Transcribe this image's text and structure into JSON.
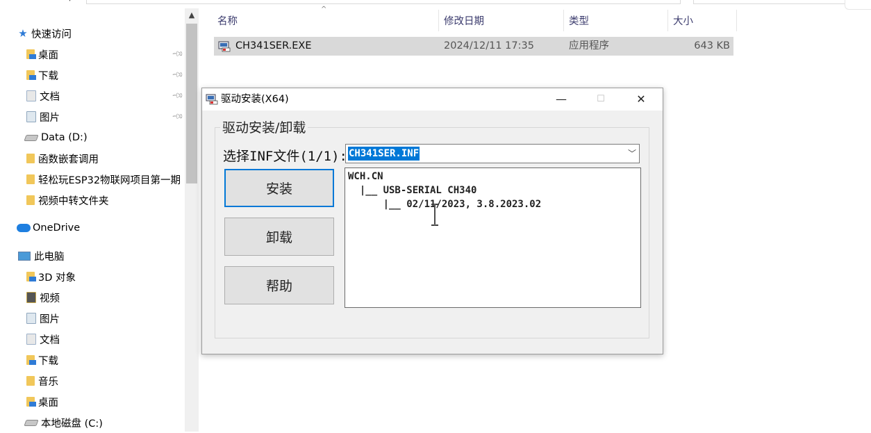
{
  "nav": {
    "items": [
      {
        "label": "快速访问",
        "icon": "star-icon"
      },
      {
        "label": "桌面",
        "icon": "folder-desktop-icon",
        "pinned": true
      },
      {
        "label": "下载",
        "icon": "folder-download-icon",
        "pinned": true
      },
      {
        "label": "文档",
        "icon": "folder-documents-icon",
        "pinned": true
      },
      {
        "label": "图片",
        "icon": "folder-pictures-icon",
        "pinned": true
      },
      {
        "label": "Data (D:)",
        "icon": "drive-icon"
      },
      {
        "label": "函数嵌套调用",
        "icon": "folder-icon"
      },
      {
        "label": "轻松玩ESP32物联网项目第一期",
        "icon": "folder-icon"
      },
      {
        "label": "视频中转文件夹",
        "icon": "folder-icon"
      },
      {
        "label": "OneDrive",
        "icon": "onedrive-cloud-icon"
      },
      {
        "label": "此电脑",
        "icon": "this-pc-icon"
      },
      {
        "label": "3D 对象",
        "icon": "folder-3d-icon"
      },
      {
        "label": "视频",
        "icon": "folder-videos-icon"
      },
      {
        "label": "图片",
        "icon": "folder-pictures-icon"
      },
      {
        "label": "文档",
        "icon": "folder-documents-icon"
      },
      {
        "label": "下载",
        "icon": "folder-download-icon"
      },
      {
        "label": "音乐",
        "icon": "folder-music-icon"
      },
      {
        "label": "桌面",
        "icon": "folder-desktop-icon"
      },
      {
        "label": "本地磁盘 (C:)",
        "icon": "local-disk-icon"
      }
    ]
  },
  "filelist": {
    "headers": {
      "name": "名称",
      "modified": "修改日期",
      "type": "类型",
      "size": "大小"
    },
    "rows": [
      {
        "name": "CH341SER.EXE",
        "modified": "2024/12/11 17:35",
        "type": "应用程序",
        "size": "643 KB"
      }
    ]
  },
  "dialog": {
    "title": "驱动安装(X64)",
    "controls": {
      "minimize": "—",
      "maximize": "☐",
      "close": "✕"
    },
    "group_label": "驱动安装/卸载",
    "inf_label_cjk1": "选择",
    "inf_label_mid": "INF",
    "inf_label_cjk2": "文件",
    "inf_label_count": "(1/1):",
    "inf_selected": "CH341SER.INF",
    "buttons": {
      "install": "安装",
      "uninstall": "卸载",
      "help": "帮助"
    },
    "info_lines": [
      "WCH.CN",
      "  |__ USB-SERIAL CH340",
      "      |__ 02/11/2023, 3.8.2023.02"
    ]
  },
  "colors": {
    "selection": "#0078d7",
    "row_selected": "#d9d9d9",
    "dialog_bg": "#f0f0f0"
  }
}
